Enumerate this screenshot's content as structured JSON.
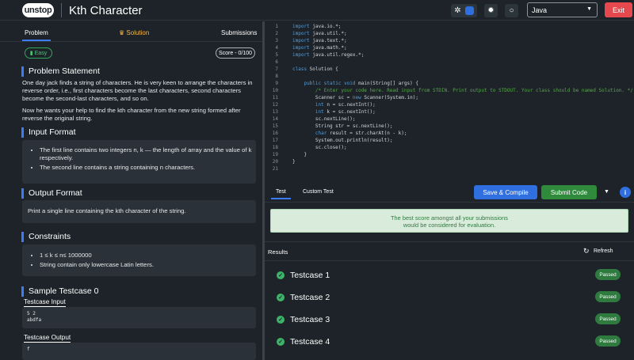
{
  "app": {
    "logo_text": "unstop",
    "title": "Kth Character",
    "language": "Java",
    "exit_label": "Exit"
  },
  "tabs": {
    "problem": "Problem",
    "solution": "Solution",
    "submissions": "Submissions"
  },
  "difficulty": "Easy",
  "score": "Score - 0/100",
  "problem_statement": {
    "heading": "Problem Statement",
    "p1": "One day jack finds a string of characters. He is very keen to arrange the characters in reverse order, i.e., first characters become the last characters, second characters become the second-last characters, and so on.",
    "p2": "Now he wants your help  to find the kth character from the new string formed after reverse the original string."
  },
  "input_format": {
    "heading": "Input Format",
    "items": [
      "The first line contains two integers n, k — the length of array and the value of k respectively.",
      "The second line contains a string containing n characters."
    ]
  },
  "output_format": {
    "heading": "Output Format",
    "text": "Print a single line containing the kth character of the string."
  },
  "constraints": {
    "heading": "Constraints",
    "items": [
      "1 ≤ k ≤ n≤ 1000000",
      "String contain only lowercase Latin letters."
    ]
  },
  "sample": {
    "heading": "Sample Testcase 0",
    "input_label": "Testcase Input",
    "input_lines": [
      "5 2",
      "abdfa"
    ],
    "output_label": "Testcase Output",
    "output_text": "f"
  },
  "editor": {
    "lines": [
      "import java.io.*;",
      "import java.util.*;",
      "import java.text.*;",
      "import java.math.*;",
      "import java.util.regex.*;",
      "",
      "class Solution {",
      "",
      "    public static void main(String[] args) {",
      "        /* Enter your code here. Read input from STDIN. Print output to STDOUT. Your class should be named Solution. */",
      "        Scanner sc = new Scanner(System.in);",
      "        int n = sc.nextInt();",
      "        int k = sc.nextInt();",
      "        sc.nextLine();",
      "        String str = sc.nextLine();",
      "        char result = str.charAt(n - k);",
      "        System.out.println(result);",
      "        sc.close();",
      "    }",
      "}",
      ""
    ]
  },
  "run_panel": {
    "tab_test": "Test",
    "tab_custom": "Custom Test",
    "save_compile": "Save & Compile",
    "submit": "Submit Code",
    "notice_line1": "The best score amongst all your submissions",
    "notice_line2": "would be considered for evaluation.",
    "results_label": "Results",
    "refresh_label": "Refresh",
    "testcases": [
      {
        "label": "Testcase 1",
        "status": "Passed"
      },
      {
        "label": "Testcase 2",
        "status": "Passed"
      },
      {
        "label": "Testcase 3",
        "status": "Passed"
      },
      {
        "label": "Testcase 4",
        "status": "Passed"
      }
    ]
  },
  "colors": {
    "accent": "#3d7cf5",
    "passed": "#2f7a3f",
    "exit": "#e5484d"
  }
}
